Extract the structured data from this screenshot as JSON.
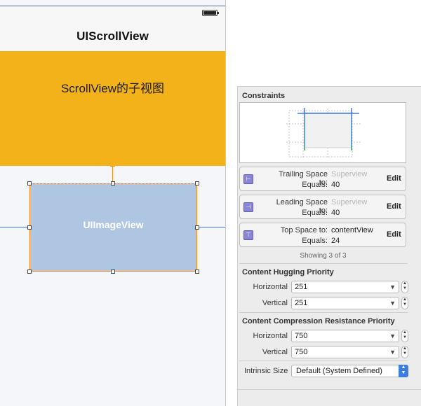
{
  "nav": {
    "title": "UIScrollView"
  },
  "content_view": {
    "label": "ScrollView的子视图"
  },
  "image_view": {
    "label": "UIImageView"
  },
  "inspector": {
    "constraints_title": "Constraints",
    "constraints": [
      {
        "label": "Trailing Space to:",
        "target": "Superview",
        "equals_label": "Equals:",
        "value": "40",
        "edit": "Edit",
        "icon": "trailing-constraint-icon",
        "target_style": "gray"
      },
      {
        "label": "Leading Space to:",
        "target": "Superview",
        "equals_label": "Equals:",
        "value": "40",
        "edit": "Edit",
        "icon": "leading-constraint-icon",
        "target_style": "gray"
      },
      {
        "label": "Top Space to:",
        "target": "contentView",
        "equals_label": "Equals:",
        "value": "24",
        "edit": "Edit",
        "icon": "top-constraint-icon",
        "target_style": "black"
      }
    ],
    "showing": "Showing 3 of 3",
    "hugging": {
      "title": "Content Hugging Priority",
      "horizontal_label": "Horizontal",
      "horizontal_value": "251",
      "vertical_label": "Vertical",
      "vertical_value": "251"
    },
    "compression": {
      "title": "Content Compression Resistance Priority",
      "horizontal_label": "Horizontal",
      "horizontal_value": "750",
      "vertical_label": "Vertical",
      "vertical_value": "750"
    },
    "intrinsic": {
      "label": "Intrinsic Size",
      "value": "Default (System Defined)"
    }
  },
  "colors": {
    "orange": "#f3b21a",
    "image_blue": "#afc6e3",
    "constraint_blue": "#3f7bd8",
    "selection_orange": "#ff8c1a"
  }
}
